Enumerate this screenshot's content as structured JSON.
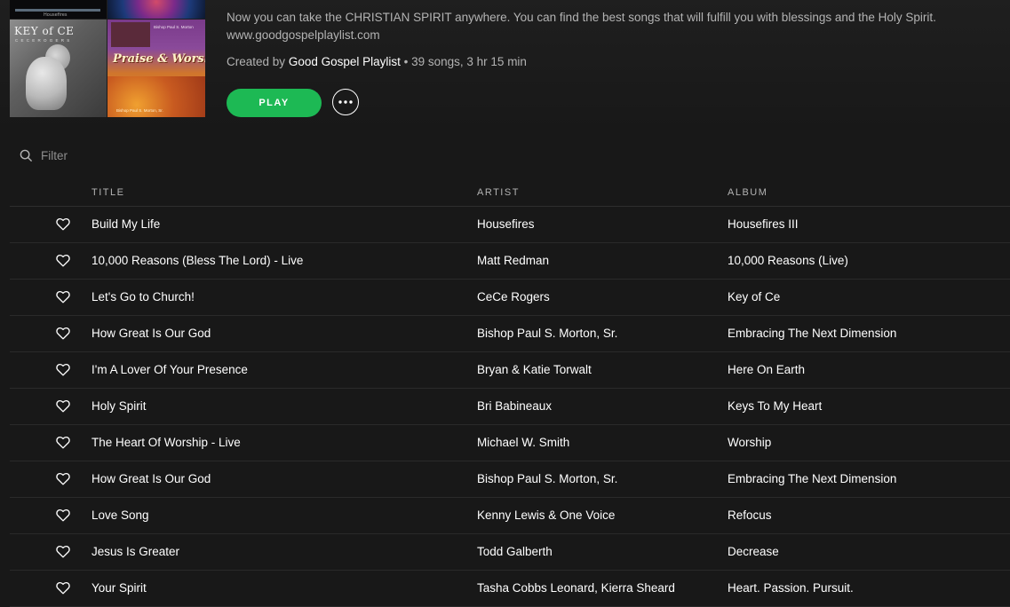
{
  "playlist": {
    "description_line1": "Now you can take the CHRISTIAN SPIRIT anywhere. You can find the best songs that will fulfill you with blessings and the Holy Spirit.",
    "description_line2": "www.goodgospelplaylist.com",
    "created_by_label": "Created by",
    "owner": "Good Gospel Playlist",
    "stats": "• 39 songs, 3 hr 15 min",
    "cover_texts": {
      "key_of_ce_title": "KEY of CE",
      "key_of_ce_sub": "C E C E  R O G E R S",
      "praise_title": "Praise & Worship",
      "praise_info": "Bishop Paul S. Morton",
      "praise_footer": "Bishop Paul S. Morton, Sr.",
      "top_left_caption": "Housefires"
    }
  },
  "controls": {
    "play_label": "PLAY",
    "more_icon": "ellipsis-icon"
  },
  "filter": {
    "placeholder": "Filter",
    "icon": "search-icon"
  },
  "columns": {
    "title": "TITLE",
    "artist": "ARTIST",
    "album": "ALBUM"
  },
  "tracks": [
    {
      "title": "Build My Life",
      "artist": "Housefires",
      "album": "Housefires III"
    },
    {
      "title": "10,000 Reasons (Bless The Lord) - Live",
      "artist": "Matt Redman",
      "album": "10,000 Reasons (Live)"
    },
    {
      "title": "Let's Go to Church!",
      "artist": "CeCe Rogers",
      "album": "Key of Ce"
    },
    {
      "title": "How Great Is Our God",
      "artist": "Bishop Paul S. Morton, Sr.",
      "album": "Embracing The Next Dimension"
    },
    {
      "title": "I'm A Lover Of Your Presence",
      "artist": "Bryan & Katie Torwalt",
      "album": "Here On Earth"
    },
    {
      "title": "Holy Spirit",
      "artist": "Bri Babineaux",
      "album": "Keys To My Heart"
    },
    {
      "title": "The Heart Of Worship - Live",
      "artist": "Michael W. Smith",
      "album": "Worship"
    },
    {
      "title": "How Great Is Our God",
      "artist": "Bishop Paul S. Morton, Sr.",
      "album": "Embracing The Next Dimension"
    },
    {
      "title": "Love Song",
      "artist": "Kenny Lewis & One Voice",
      "album": "Refocus"
    },
    {
      "title": "Jesus Is Greater",
      "artist": "Todd Galberth",
      "album": "Decrease"
    },
    {
      "title": "Your Spirit",
      "artist": "Tasha Cobbs Leonard, Kierra Sheard",
      "album": "Heart. Passion. Pursuit."
    }
  ],
  "colors": {
    "background": "#181818",
    "accent": "#1db954",
    "text_primary": "#ffffff",
    "text_secondary": "#b3b3b3"
  }
}
